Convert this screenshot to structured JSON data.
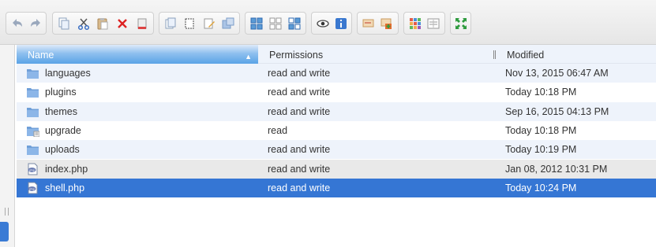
{
  "toolbar": {
    "groups": [
      {
        "name": "history",
        "buttons": [
          "back-icon",
          "forward-icon"
        ]
      },
      {
        "name": "edit",
        "buttons": [
          "copy-icon",
          "cut-icon",
          "paste-icon",
          "delete-icon",
          "empty-icon"
        ]
      },
      {
        "name": "create",
        "buttons": [
          "duplicate-icon",
          "new-folder-icon",
          "new-file-icon",
          "extract-icon"
        ]
      },
      {
        "name": "view",
        "buttons": [
          "icons-view-icon",
          "select-all-icon",
          "select-invert-icon"
        ]
      },
      {
        "name": "info",
        "buttons": [
          "preview-icon",
          "info-icon"
        ]
      },
      {
        "name": "tools",
        "buttons": [
          "rename-icon",
          "edit-file-icon"
        ]
      },
      {
        "name": "display",
        "buttons": [
          "grid-view-icon",
          "list-view-icon"
        ]
      },
      {
        "name": "window",
        "buttons": [
          "fullscreen-icon"
        ]
      }
    ]
  },
  "table": {
    "headers": {
      "name": "Name",
      "permissions": "Permissions",
      "modified": "Modified"
    },
    "sort_indicator": "▲",
    "rows": [
      {
        "icon": "folder-icon",
        "name": "languages",
        "permissions": "read and write",
        "modified": "Nov 13, 2015 06:47 AM",
        "state": "alt"
      },
      {
        "icon": "folder-icon",
        "name": "plugins",
        "permissions": "read and write",
        "modified": "Today 10:18 PM",
        "state": "plain"
      },
      {
        "icon": "folder-icon",
        "name": "themes",
        "permissions": "read and write",
        "modified": "Sep 16, 2015 04:13 PM",
        "state": "alt"
      },
      {
        "icon": "folder-locked-icon",
        "name": "upgrade",
        "permissions": "read",
        "modified": "Today 10:18 PM",
        "state": "plain"
      },
      {
        "icon": "folder-icon",
        "name": "uploads",
        "permissions": "read and write",
        "modified": "Today 10:19 PM",
        "state": "alt"
      },
      {
        "icon": "php-file-icon",
        "name": "index.php",
        "permissions": "read and write",
        "modified": "Jan 08, 2012 10:31 PM",
        "state": "gray"
      },
      {
        "icon": "php-file-icon",
        "name": "shell.php",
        "permissions": "read and write",
        "modified": "Today 10:24 PM",
        "state": "sel"
      }
    ]
  }
}
